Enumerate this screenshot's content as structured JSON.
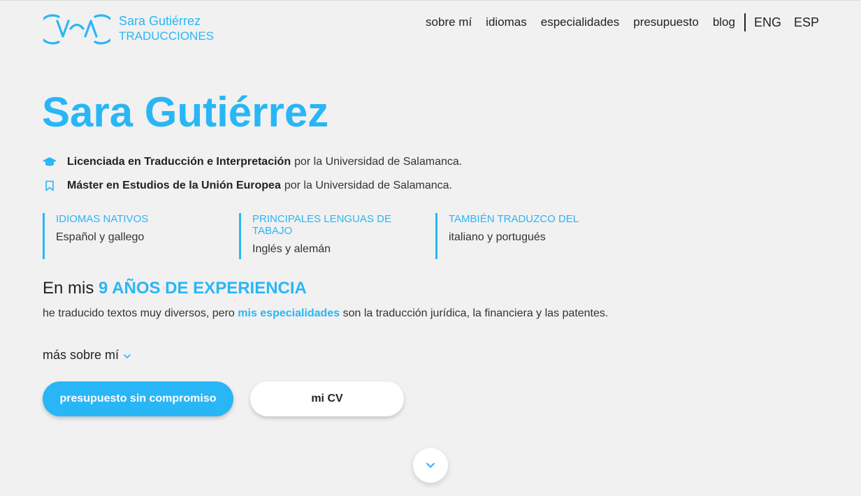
{
  "brand": {
    "name_line1": "Sara Gutiérrez",
    "name_line2": "TRADUCCIONES"
  },
  "nav": {
    "items": [
      "sobre mí",
      "idiomas",
      "especialidades",
      "presupuesto",
      "blog"
    ],
    "languages": [
      "ENG",
      "ESP"
    ]
  },
  "hero": {
    "title": "Sara Gutiérrez",
    "degrees": [
      {
        "icon": "graduation-cap-icon",
        "bold": "Licenciada en Traducción e Interpretación",
        "rest": "por la Universidad de Salamanca."
      },
      {
        "icon": "bookmark-icon",
        "bold": "Máster en Estudios de la Unión Europea",
        "rest": "por la Universidad de Salamanca."
      }
    ],
    "columns": [
      {
        "heading": "IDIOMAS NATIVOS",
        "value": "Español y gallego"
      },
      {
        "heading": "PRINCIPALES LENGUAS DE TABAJO",
        "value": "Inglés y alemán"
      },
      {
        "heading": "TAMBIÉN TRADUZCO DEL",
        "value": "italiano y portugués"
      }
    ],
    "experience": {
      "prefix": "En mis",
      "highlight": "9 AÑOS DE EXPERIENCIA",
      "text_before": "he traducido textos muy diversos, pero",
      "text_link": "mis especialidades",
      "text_after": "son la traducción jurídica, la financiera y las patentes."
    },
    "more_label": "más sobre mí",
    "buttons": {
      "primary": "presupuesto sin compromiso",
      "secondary": "mi CV"
    }
  },
  "colors": {
    "accent": "#29b6f6",
    "background": "#f1f1f1"
  }
}
